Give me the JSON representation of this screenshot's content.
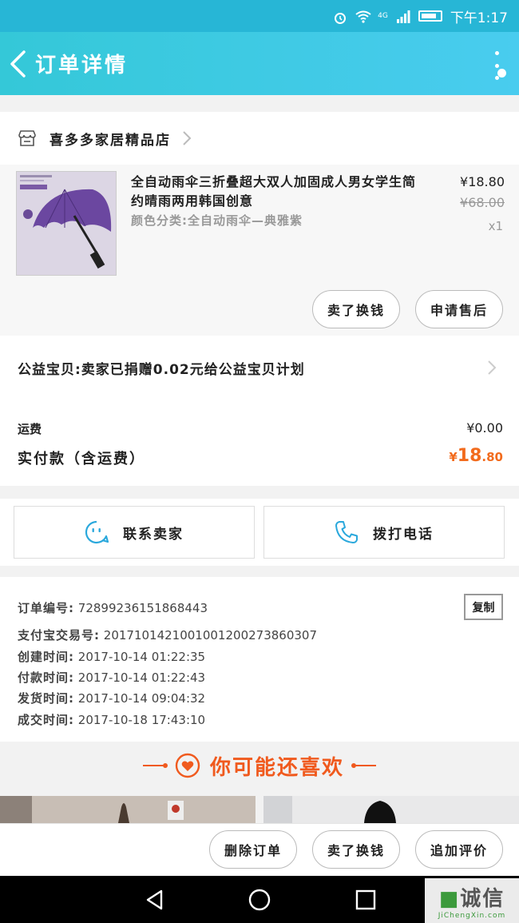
{
  "status_bar": {
    "time": "下午1:17",
    "network": "4G"
  },
  "header": {
    "title": "订单详情"
  },
  "shop": {
    "name": "喜多多家居精品店"
  },
  "product": {
    "title": "全自动雨伞三折叠超大双人加固成人男女学生简约晴雨两用韩国创意",
    "variant": "颜色分类:全自动雨伞—典雅紫",
    "price": "¥18.80",
    "original_price": "¥68.00",
    "quantity": "x1",
    "actions": [
      "卖了换钱",
      "申请售后"
    ]
  },
  "charity": {
    "text": "公益宝贝:卖家已捐赠0.02元给公益宝贝计划"
  },
  "summary": {
    "shipping_label": "运费",
    "shipping_value": "¥0.00",
    "paid_label": "实付款（含运费）",
    "paid_currency": "¥",
    "paid_major": "18",
    "paid_minor": ".80"
  },
  "contact": {
    "seller_label": "联系卖家",
    "call_label": "拨打电话"
  },
  "order_info": {
    "copy_label": "复制",
    "lines": [
      {
        "key": "订单编号:",
        "value": "72899236151868443"
      },
      {
        "key": "支付宝交易号:",
        "value": "2017101421001001200273860307"
      },
      {
        "key": "创建时间:",
        "value": "2017-10-14 01:22:35"
      },
      {
        "key": "付款时间:",
        "value": "2017-10-14 01:22:43"
      },
      {
        "key": "发货时间:",
        "value": "2017-10-14 09:04:32"
      },
      {
        "key": "成交时间:",
        "value": "2017-10-18 17:43:10"
      }
    ]
  },
  "recommend": {
    "title": "你可能还喜欢"
  },
  "bottom_actions": [
    "删除订单",
    "卖了换钱",
    "追加评价"
  ],
  "watermark": {
    "brand": "诚信",
    "site": "JiChengXin.com"
  },
  "colors": {
    "accent": "#27b6d6",
    "price_orange": "#f26b1d",
    "recommend_orange": "#f05a1e"
  },
  "icons": [
    "back-arrow-icon",
    "more-vertical-icon",
    "store-icon",
    "chevron-right-icon",
    "chat-face-icon",
    "phone-icon",
    "heart-icon"
  ]
}
